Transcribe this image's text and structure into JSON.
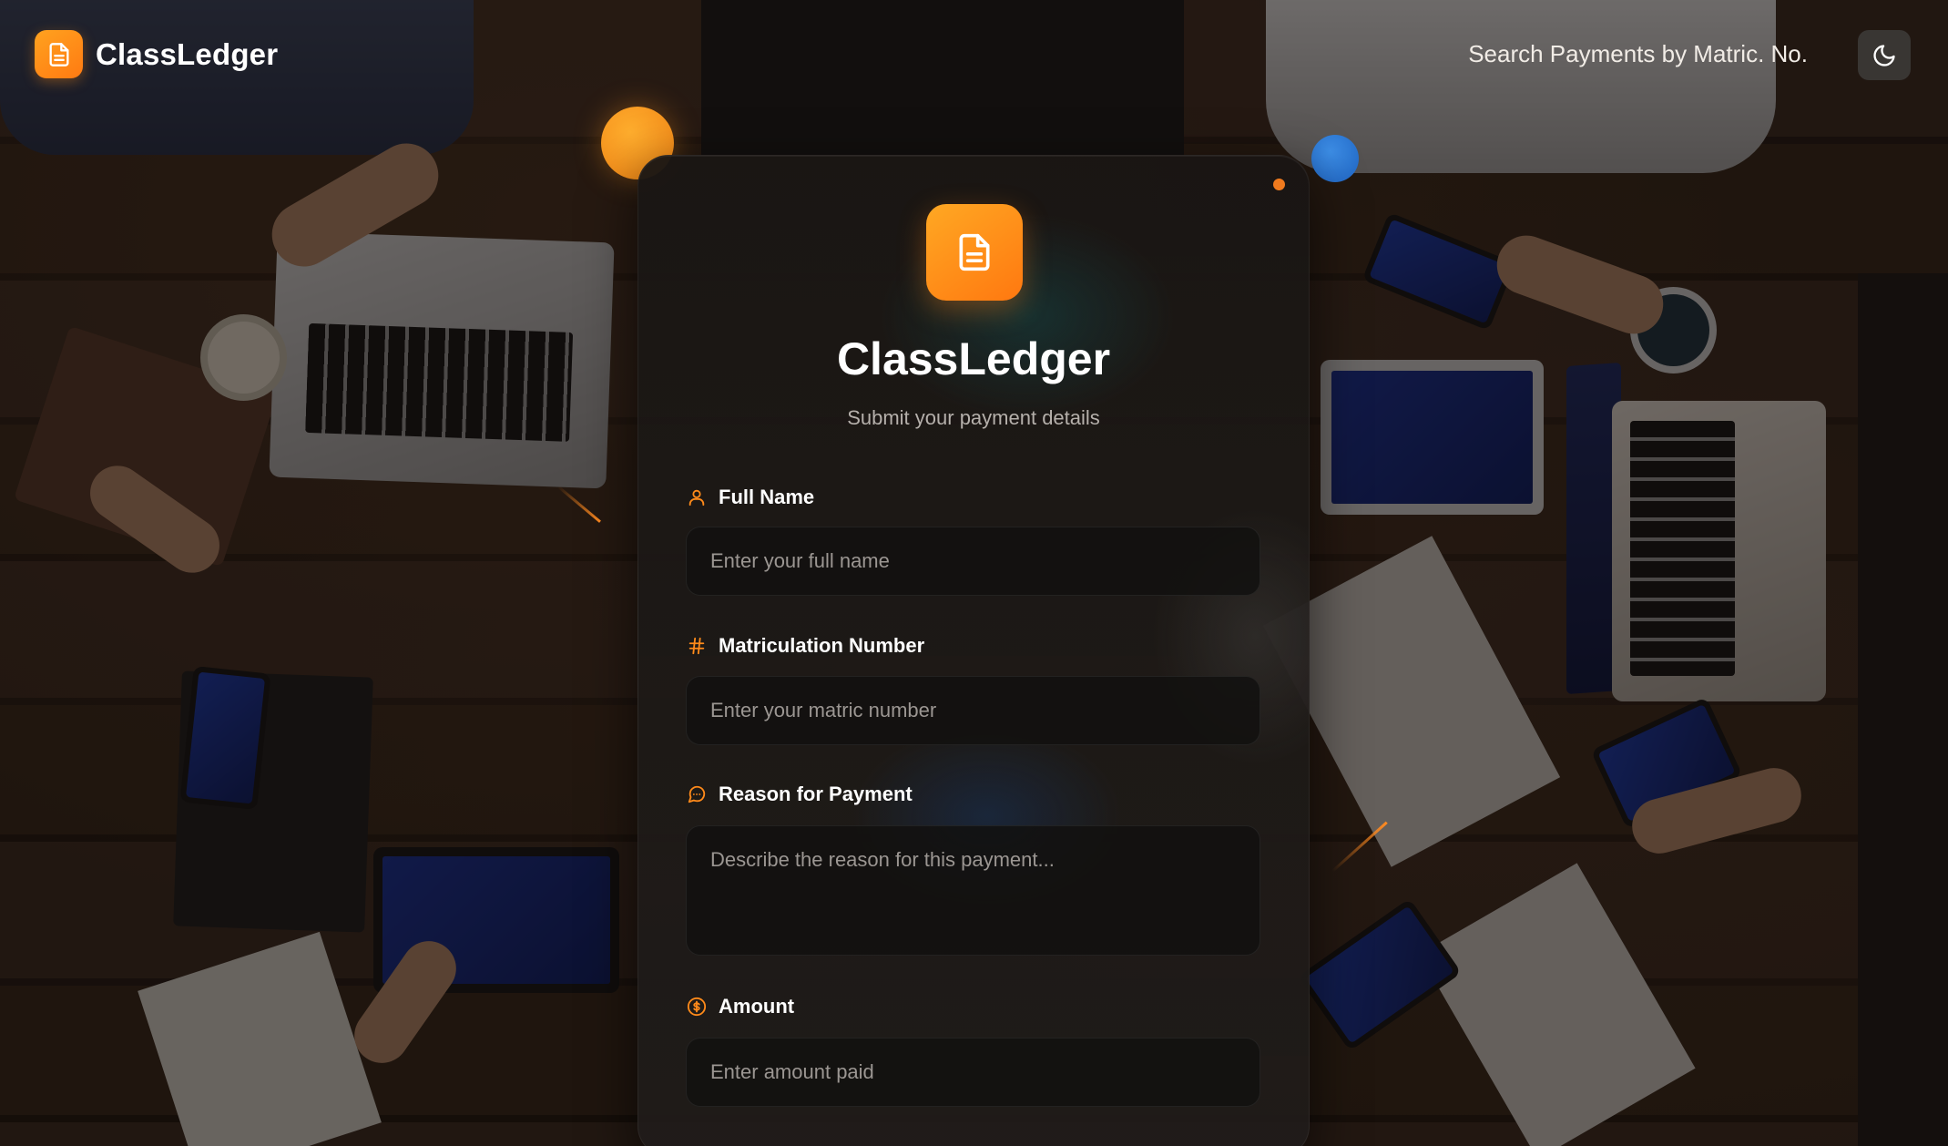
{
  "header": {
    "brand_name": "ClassLedger",
    "brand_icon": "document-icon",
    "search_link": "Search Payments by Matric. No.",
    "theme_toggle_icon": "moon-icon"
  },
  "card": {
    "icon": "document-icon",
    "title": "ClassLedger",
    "subtitle": "Submit your payment details",
    "fields": {
      "full_name": {
        "icon": "user-icon",
        "label": "Full Name",
        "placeholder": "Enter your full name",
        "value": ""
      },
      "matric": {
        "icon": "hash-icon",
        "label": "Matriculation Number",
        "placeholder": "Enter your matric number",
        "value": ""
      },
      "reason": {
        "icon": "message-circle-icon",
        "label": "Reason for Payment",
        "placeholder": "Describe the reason for this payment...",
        "value": ""
      },
      "amount": {
        "icon": "dollar-circle-icon",
        "label": "Amount",
        "placeholder": "Enter amount paid",
        "value": ""
      }
    }
  },
  "colors": {
    "accent": "#FF8A1A",
    "accent_light": "#FFA823",
    "secondary_orb": "#2F7FD8",
    "card_bg": "#1A1614",
    "input_bg": "#12100F",
    "muted_text": "#B5B0AB"
  }
}
